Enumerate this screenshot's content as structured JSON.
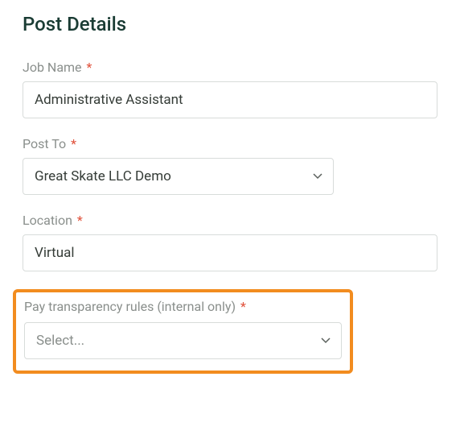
{
  "page": {
    "title": "Post Details"
  },
  "fields": {
    "jobName": {
      "label": "Job Name",
      "required": "*",
      "value": "Administrative Assistant"
    },
    "postTo": {
      "label": "Post To",
      "required": "*",
      "value": "Great Skate LLC Demo"
    },
    "location": {
      "label": "Location",
      "required": "*",
      "value": "Virtual"
    },
    "payTransparency": {
      "label": "Pay transparency rules (internal only)",
      "required": "*",
      "placeholder": "Select..."
    }
  }
}
